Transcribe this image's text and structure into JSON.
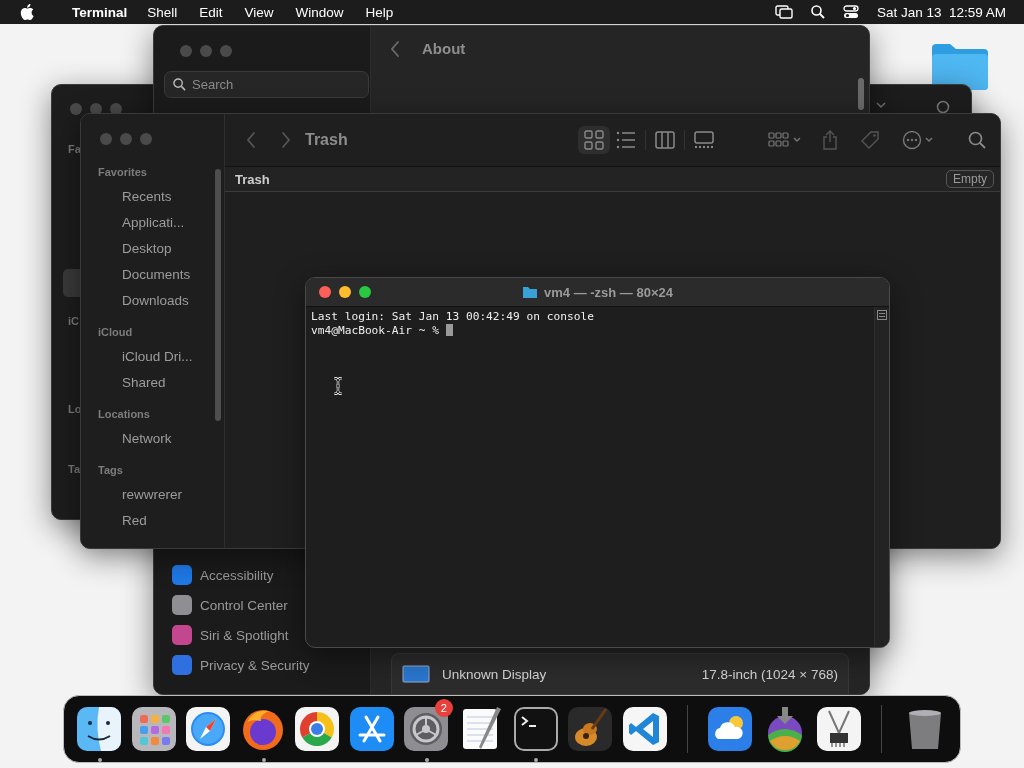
{
  "menu_bar": {
    "app_name": "Terminal",
    "menus": [
      "Shell",
      "Edit",
      "View",
      "Window",
      "Help"
    ],
    "clock": "Sat Jan 13  12:59 AM"
  },
  "settings_window": {
    "search": {
      "placeholder": "Search"
    },
    "header": {
      "title": "About"
    },
    "sidebar_items": [
      {
        "label": "Accessibility",
        "color": "#1f7ae8"
      },
      {
        "label": "Control Center",
        "color": "#8e8e93"
      },
      {
        "label": "Siri & Spotlight",
        "color": "#c2478f"
      },
      {
        "label": "Privacy & Security",
        "color": "#2f6fe0"
      }
    ],
    "display_row": {
      "name": "Unknown Display",
      "detail": "17.8-inch (1024 × 768)"
    }
  },
  "back_finder_window": {
    "sidebar_labels": [
      "Fa",
      "iC",
      "Lo",
      "Ta"
    ]
  },
  "finder_window": {
    "title": "Trash",
    "path_title": "Trash",
    "empty_button": "Empty",
    "views": [
      {
        "selected": true
      },
      {
        "selected": false
      },
      {
        "selected": false
      },
      {
        "selected": false
      }
    ],
    "sidebar": [
      {
        "heading": "Favorites",
        "items": [
          "Recents",
          "Applicati...",
          "Desktop",
          "Documents",
          "Downloads"
        ]
      },
      {
        "heading": "iCloud",
        "items": [
          "iCloud Dri...",
          "Shared"
        ]
      },
      {
        "heading": "Locations",
        "items": [
          "Network"
        ]
      },
      {
        "heading": "Tags",
        "items": [
          "rewwrerer",
          "Red"
        ]
      }
    ]
  },
  "terminal_window": {
    "title": "vm4 — -zsh — 80×24",
    "lines": [
      "Last login: Sat Jan 13 00:42:49 on console"
    ],
    "prompt": "vm4@MacBook-Air ~ % "
  },
  "dock": {
    "sections": [
      [
        {
          "running": true
        },
        {
          "running": false
        },
        {
          "running": false
        },
        {
          "running": true
        },
        {
          "running": false
        },
        {
          "running": false
        },
        {
          "running": true,
          "badge": "2"
        },
        {
          "running": false
        },
        {
          "running": true
        },
        {
          "running": false
        },
        {
          "running": false
        }
      ],
      [
        {
          "running": false
        },
        {
          "running": false
        },
        {
          "running": false
        }
      ],
      [
        {
          "running": false
        }
      ]
    ]
  }
}
